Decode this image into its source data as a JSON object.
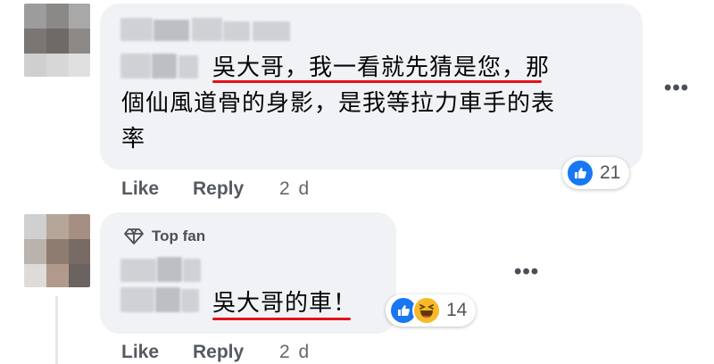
{
  "comments": [
    {
      "text_lines": [
        "吳大哥，我一看就先猜是您，那",
        "個仙風道骨的身影，是我等拉力車手的表",
        "率"
      ],
      "reaction_count": "21",
      "like_label": "Like",
      "reply_label": "Reply",
      "time": "2 d"
    },
    {
      "badge": "Top fan",
      "text": "吳大哥的車！",
      "reaction_count": "14",
      "like_label": "Like",
      "reply_label": "Reply",
      "time": "2 d"
    }
  ],
  "more_icon": "more-horizontal-icon",
  "reactions": [
    "like-icon",
    "haha-icon"
  ],
  "colors": {
    "bubble": "#f0f2f5",
    "like_blue": "#1877f2",
    "haha_yellow": "#f7b928",
    "underline_red": "#e4111b"
  }
}
